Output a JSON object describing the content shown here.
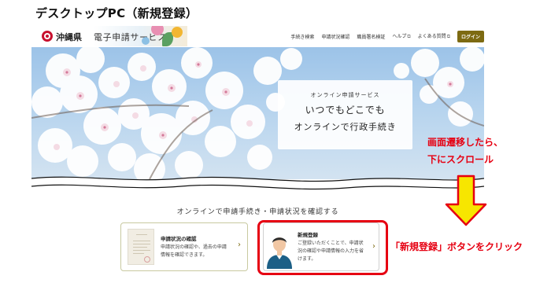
{
  "page_heading": "デスクトップPC（新規登録）",
  "header": {
    "prefecture": "沖縄県",
    "service": "電子申請サービス",
    "nav": [
      {
        "label": "手続き検索",
        "external": false
      },
      {
        "label": "申請状況確認",
        "external": false
      },
      {
        "label": "職員署名検証",
        "external": false
      },
      {
        "label": "ヘルプ",
        "external": true
      },
      {
        "label": "よくある質問",
        "external": true
      }
    ],
    "external_icon": "⧉",
    "login_label": "ログイン"
  },
  "hero": {
    "subtitle": "オンライン申請サービス",
    "line1": "いつでもどこでも",
    "line2": "オンラインで行政手続き"
  },
  "annotations": {
    "scroll_line1": "画面遷移したら、",
    "scroll_line2": "下にスクロール",
    "click": "「新規登録」ボタンをクリック"
  },
  "section": {
    "title": "オンラインで申請手続き・申請状況を確認する",
    "status_card": {
      "title": "申請状況の確認",
      "desc_line1": "申請状況の確認や、過去の申請",
      "desc_line2": "情報を確認できます。"
    },
    "register_card": {
      "title": "新規登録",
      "desc_line1": "ご登録いただくことで、申請状",
      "desc_line2": "況の確認や申請情報の入力を省",
      "desc_line3": "けます。"
    },
    "chevron": "›"
  },
  "colors": {
    "accent_red": "#e60012",
    "brand_olive": "#7d6a12",
    "arrow_yellow": "#f7e600"
  }
}
